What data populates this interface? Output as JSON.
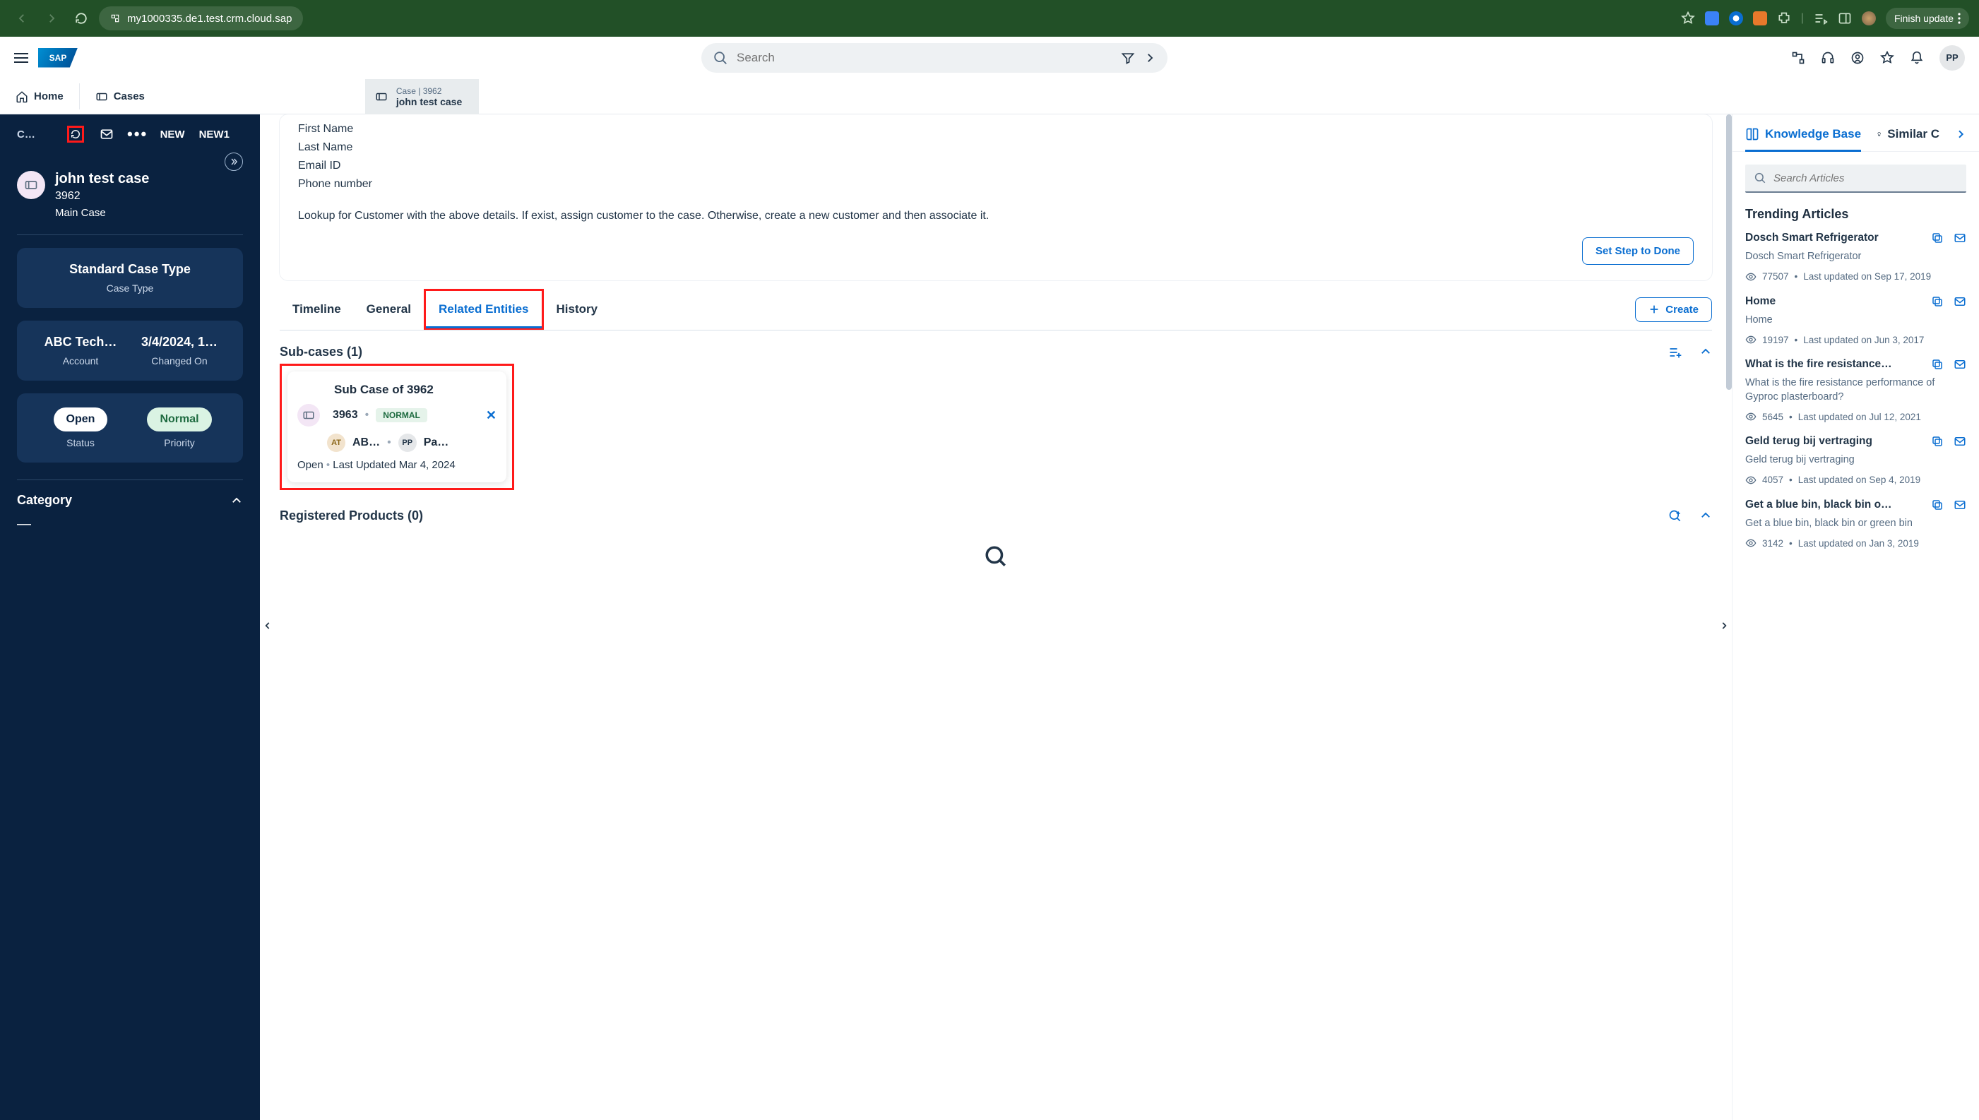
{
  "browser": {
    "url": "my1000335.de1.test.crm.cloud.sap",
    "finish_label": "Finish update"
  },
  "header": {
    "search_placeholder": "Search",
    "avatar": "PP"
  },
  "crumbs": {
    "home": "Home",
    "cases": "Cases",
    "case_tab_kicker": "Case | 3962",
    "case_tab_title": "john test case"
  },
  "sidebar": {
    "c_ellipsis": "C…",
    "new1": "NEW",
    "new2": "NEW1",
    "case_title": "john test case",
    "case_number": "3962",
    "case_kind": "Main Case",
    "type_card": {
      "value": "Standard Case Type",
      "label": "Case Type"
    },
    "info_card": {
      "account_value": "ABC Tech…",
      "account_label": "Account",
      "changed_value": "3/4/2024, 1…",
      "changed_label": "Changed On"
    },
    "status_card": {
      "status_value": "Open",
      "status_label": "Status",
      "priority_value": "Normal",
      "priority_label": "Priority"
    },
    "category_label": "Category",
    "category_value": "—"
  },
  "main": {
    "fields": [
      "First Name",
      "Last Name",
      "Email ID",
      "Phone number"
    ],
    "hint": "Lookup for Customer with the above details. If exist, assign customer to the case. Otherwise, create a new customer and then associate it.",
    "set_step": "Set Step to Done",
    "tabs": {
      "timeline": "Timeline",
      "general": "General",
      "related": "Related Entities",
      "history": "History",
      "create": "Create"
    },
    "subcases": {
      "heading": "Sub-cases (1)",
      "card": {
        "title": "Sub Case of 3962",
        "id": "3963",
        "priority": "NORMAL",
        "assignee1_initials": "AT",
        "assignee1_name": "AB…",
        "assignee2_initials": "PP",
        "assignee2_name": "Pa…",
        "status": "Open",
        "updated": "Last Updated Mar 4, 2024"
      }
    },
    "registered": "Registered Products (0)"
  },
  "kb": {
    "tab_kb": "Knowledge Base",
    "tab_similar": "Similar C",
    "search_placeholder": "Search Articles",
    "trending": "Trending Articles",
    "articles": [
      {
        "title": "Dosch Smart Refrigerator",
        "desc": "Dosch Smart Refrigerator",
        "views": "77507",
        "updated": "Last updated on Sep 17, 2019"
      },
      {
        "title": "Home",
        "desc": "Home",
        "views": "19197",
        "updated": "Last updated on Jun 3, 2017"
      },
      {
        "title": "What is the fire resistance…",
        "desc": "What is the fire resistance performance of Gyproc plasterboard?",
        "views": "5645",
        "updated": "Last updated on Jul 12, 2021"
      },
      {
        "title": "Geld terug bij vertraging",
        "desc": "Geld terug bij vertraging",
        "views": "4057",
        "updated": "Last updated on Sep 4, 2019"
      },
      {
        "title": "Get a blue bin, black bin o…",
        "desc": "Get a blue bin, black bin or green bin",
        "views": "3142",
        "updated": "Last updated on Jan 3, 2019"
      }
    ]
  }
}
